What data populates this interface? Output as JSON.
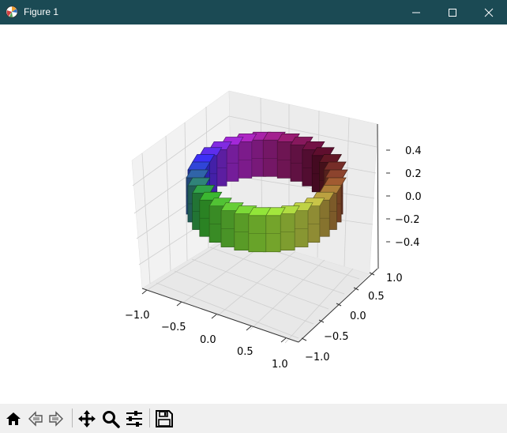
{
  "window": {
    "title": "Figure 1",
    "controls": [
      "minimize",
      "maximize",
      "close"
    ]
  },
  "toolbar": {
    "buttons": [
      {
        "name": "home",
        "icon": "home-icon"
      },
      {
        "name": "back",
        "icon": "back-arrow-icon"
      },
      {
        "name": "forward",
        "icon": "forward-arrow-icon"
      },
      {
        "name": "pan",
        "icon": "move-icon"
      },
      {
        "name": "zoom",
        "icon": "magnifier-icon"
      },
      {
        "name": "configure-subplots",
        "icon": "sliders-icon"
      },
      {
        "name": "save",
        "icon": "floppy-disk-icon"
      }
    ]
  },
  "chart_data": {
    "type": "voxels",
    "x_ticks": [
      "−1.0",
      "−0.5",
      "0.0",
      "0.5",
      "1.0"
    ],
    "y_ticks": [
      "−1.0",
      "−0.5",
      "0.0",
      "0.5",
      "1.0"
    ],
    "z_ticks": [
      "−0.4",
      "−0.2",
      "0.0",
      "0.2",
      "0.4"
    ],
    "xlim": [
      -1.0,
      1.0
    ],
    "ylim": [
      -1.0,
      1.0
    ],
    "zlim": [
      -0.5,
      0.5
    ],
    "grid": true,
    "colors": {
      "pane": "#f2f2f2",
      "grid": "#cfcfcf",
      "blue": "#2a2ad8",
      "purple": "#9a22b8",
      "magenta": "#8a1a6a",
      "maroon": "#4a0a1e",
      "brown": "#8a4a2a",
      "olive": "#b0b040",
      "lime": "#88cc33",
      "green": "#2a9a2a"
    }
  }
}
